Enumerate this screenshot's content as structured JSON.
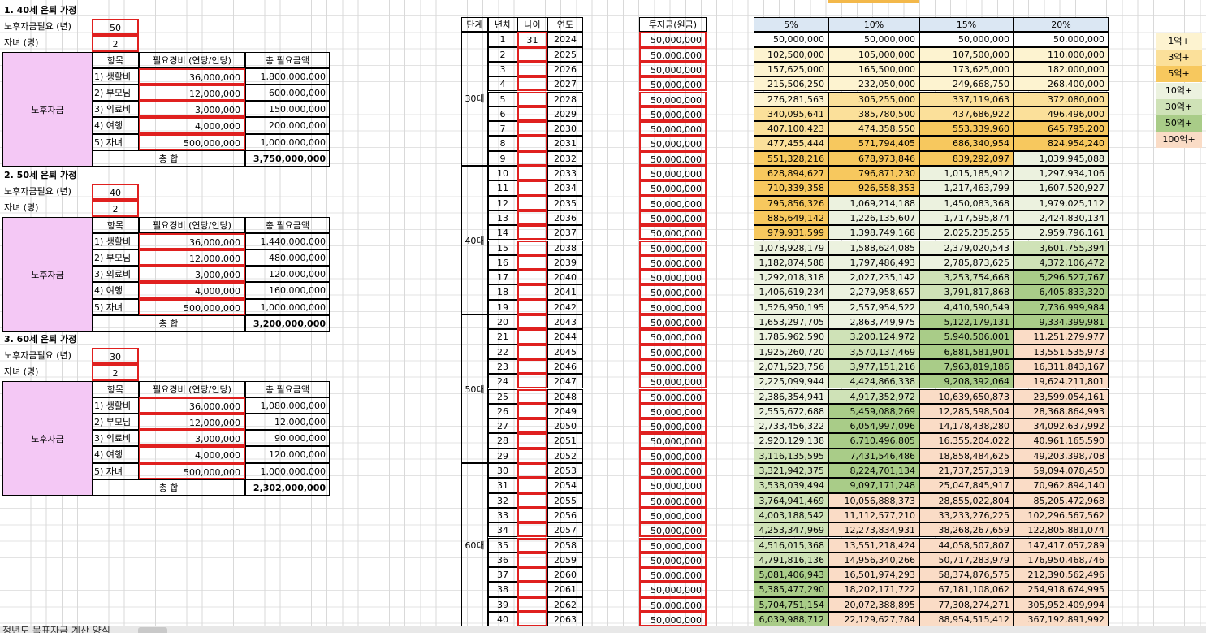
{
  "sections": [
    {
      "title": "1. 40세 은퇴 가정",
      "param1_label": "노후자금필요 (년)",
      "param1_value": "50",
      "param2_label": "자녀 (명)",
      "param2_value": "2",
      "block_label": "노후자금",
      "col_item": "항목",
      "col_expense": "필요경비 (연당/인당)",
      "col_total": "총 필요금액",
      "rows": [
        [
          "1) 생활비",
          "36,000,000",
          "1,800,000,000"
        ],
        [
          "2) 부모님",
          "12,000,000",
          "600,000,000"
        ],
        [
          "3) 의료비",
          "3,000,000",
          "150,000,000"
        ],
        [
          "4) 여행",
          "4,000,000",
          "200,000,000"
        ],
        [
          "5) 자녀",
          "500,000,000",
          "1,000,000,000"
        ]
      ],
      "sum_label": "총 합",
      "sum_value": "3,750,000,000"
    },
    {
      "title": "2. 50세 은퇴 가정",
      "param1_label": "노후자금필요 (년)",
      "param1_value": "40",
      "param2_label": "자녀 (명)",
      "param2_value": "2",
      "block_label": "노후자금",
      "col_item": "항목",
      "col_expense": "필요경비 (연당/인당)",
      "col_total": "총 필요금액",
      "rows": [
        [
          "1) 생활비",
          "36,000,000",
          "1,440,000,000"
        ],
        [
          "2) 부모님",
          "12,000,000",
          "480,000,000"
        ],
        [
          "3) 의료비",
          "3,000,000",
          "120,000,000"
        ],
        [
          "4) 여행",
          "4,000,000",
          "160,000,000"
        ],
        [
          "5) 자녀",
          "500,000,000",
          "1,000,000,000"
        ]
      ],
      "sum_label": "총 합",
      "sum_value": "3,200,000,000"
    },
    {
      "title": "3. 60세 은퇴 가정",
      "param1_label": "노후자금필요 (년)",
      "param1_value": "30",
      "param2_label": "자녀 (명)",
      "param2_value": "2",
      "block_label": "노후자금",
      "col_item": "항목",
      "col_expense": "필요경비 (연당/인당)",
      "col_total": "총 필요금액",
      "rows": [
        [
          "1) 생활비",
          "36,000,000",
          "1,080,000,000"
        ],
        [
          "2) 부모님",
          "12,000,000",
          "12,000,000"
        ],
        [
          "3) 의료비",
          "3,000,000",
          "90,000,000"
        ],
        [
          "4) 여행",
          "4,000,000",
          "120,000,000"
        ],
        [
          "5) 자녀",
          "500,000,000",
          "1,000,000,000"
        ]
      ],
      "sum_label": "총 합",
      "sum_value": "2,302,000,000"
    }
  ],
  "main": {
    "headers": {
      "stage": "단계",
      "year_no": "년차",
      "age": "나이",
      "year": "연도",
      "invest": "투자금(원금)",
      "r5": "5%",
      "r10": "10%",
      "r15": "15%",
      "r20": "20%"
    },
    "stages": [
      {
        "label": "30대",
        "start": 1,
        "end": 9
      },
      {
        "label": "40대",
        "start": 10,
        "end": 19
      },
      {
        "label": "50대",
        "start": 20,
        "end": 29
      },
      {
        "label": "60대",
        "start": 30,
        "end": 40
      }
    ],
    "first_age": "31",
    "invest_value": "50,000,000",
    "rows": [
      [
        "1",
        "2024",
        "50,000,000",
        "50,000,000",
        "50,000,000",
        "50,000,000"
      ],
      [
        "2",
        "2025",
        "102,500,000",
        "105,000,000",
        "107,500,000",
        "110,000,000"
      ],
      [
        "3",
        "2026",
        "157,625,000",
        "165,500,000",
        "173,625,000",
        "182,000,000"
      ],
      [
        "4",
        "2027",
        "215,506,250",
        "232,050,000",
        "249,668,750",
        "268,400,000"
      ],
      [
        "5",
        "2028",
        "276,281,563",
        "305,255,000",
        "337,119,063",
        "372,080,000"
      ],
      [
        "6",
        "2029",
        "340,095,641",
        "385,780,500",
        "437,686,922",
        "496,496,000"
      ],
      [
        "7",
        "2030",
        "407,100,423",
        "474,358,550",
        "553,339,960",
        "645,795,200"
      ],
      [
        "8",
        "2031",
        "477,455,444",
        "571,794,405",
        "686,340,954",
        "824,954,240"
      ],
      [
        "9",
        "2032",
        "551,328,216",
        "678,973,846",
        "839,292,097",
        "1,039,945,088"
      ],
      [
        "10",
        "2033",
        "628,894,627",
        "796,871,230",
        "1,015,185,912",
        "1,297,934,106"
      ],
      [
        "11",
        "2034",
        "710,339,358",
        "926,558,353",
        "1,217,463,799",
        "1,607,520,927"
      ],
      [
        "12",
        "2035",
        "795,856,326",
        "1,069,214,188",
        "1,450,083,368",
        "1,979,025,112"
      ],
      [
        "13",
        "2036",
        "885,649,142",
        "1,226,135,607",
        "1,717,595,874",
        "2,424,830,134"
      ],
      [
        "14",
        "2037",
        "979,931,599",
        "1,398,749,168",
        "2,025,235,255",
        "2,959,796,161"
      ],
      [
        "15",
        "2038",
        "1,078,928,179",
        "1,588,624,085",
        "2,379,020,543",
        "3,601,755,394"
      ],
      [
        "16",
        "2039",
        "1,182,874,588",
        "1,797,486,493",
        "2,785,873,625",
        "4,372,106,472"
      ],
      [
        "17",
        "2040",
        "1,292,018,318",
        "2,027,235,142",
        "3,253,754,668",
        "5,296,527,767"
      ],
      [
        "18",
        "2041",
        "1,406,619,234",
        "2,279,958,657",
        "3,791,817,868",
        "6,405,833,320"
      ],
      [
        "19",
        "2042",
        "1,526,950,195",
        "2,557,954,522",
        "4,410,590,549",
        "7,736,999,984"
      ],
      [
        "20",
        "2043",
        "1,653,297,705",
        "2,863,749,975",
        "5,122,179,131",
        "9,334,399,981"
      ],
      [
        "21",
        "2044",
        "1,785,962,590",
        "3,200,124,972",
        "5,940,506,001",
        "11,251,279,977"
      ],
      [
        "22",
        "2045",
        "1,925,260,720",
        "3,570,137,469",
        "6,881,581,901",
        "13,551,535,973"
      ],
      [
        "23",
        "2046",
        "2,071,523,756",
        "3,977,151,216",
        "7,963,819,186",
        "16,311,843,167"
      ],
      [
        "24",
        "2047",
        "2,225,099,944",
        "4,424,866,338",
        "9,208,392,064",
        "19,624,211,801"
      ],
      [
        "25",
        "2048",
        "2,386,354,941",
        "4,917,352,972",
        "10,639,650,873",
        "23,599,054,161"
      ],
      [
        "26",
        "2049",
        "2,555,672,688",
        "5,459,088,269",
        "12,285,598,504",
        "28,368,864,993"
      ],
      [
        "27",
        "2050",
        "2,733,456,322",
        "6,054,997,096",
        "14,178,438,280",
        "34,092,637,992"
      ],
      [
        "28",
        "2051",
        "2,920,129,138",
        "6,710,496,805",
        "16,355,204,022",
        "40,961,165,590"
      ],
      [
        "29",
        "2052",
        "3,116,135,595",
        "7,431,546,486",
        "18,858,484,625",
        "49,203,398,708"
      ],
      [
        "30",
        "2053",
        "3,321,942,375",
        "8,224,701,134",
        "21,737,257,319",
        "59,094,078,450"
      ],
      [
        "31",
        "2054",
        "3,538,039,494",
        "9,097,171,248",
        "25,047,845,917",
        "70,962,894,140"
      ],
      [
        "32",
        "2055",
        "3,764,941,469",
        "10,056,888,373",
        "28,855,022,804",
        "85,205,472,968"
      ],
      [
        "33",
        "2056",
        "4,003,188,542",
        "11,112,577,210",
        "33,233,276,225",
        "102,296,567,562"
      ],
      [
        "34",
        "2057",
        "4,253,347,969",
        "12,273,834,931",
        "38,268,267,659",
        "122,805,881,074"
      ],
      [
        "35",
        "2058",
        "4,516,015,368",
        "13,551,218,424",
        "44,058,507,807",
        "147,417,057,289"
      ],
      [
        "36",
        "2059",
        "4,791,816,136",
        "14,956,340,266",
        "50,717,283,979",
        "176,950,468,746"
      ],
      [
        "37",
        "2060",
        "5,081,406,943",
        "16,501,974,293",
        "58,374,876,575",
        "212,390,562,496"
      ],
      [
        "38",
        "2061",
        "5,385,477,290",
        "18,202,171,722",
        "67,181,108,062",
        "254,918,674,995"
      ],
      [
        "39",
        "2062",
        "5,704,751,154",
        "20,072,388,895",
        "77,308,274,271",
        "305,952,409,994"
      ],
      [
        "40",
        "2063",
        "6,039,988,712",
        "22,129,627,784",
        "88,954,515,412",
        "367,192,891,992"
      ]
    ]
  },
  "legend": [
    {
      "label": "1억+",
      "color": "#fdf3d0"
    },
    {
      "label": "3억+",
      "color": "#fbe09a"
    },
    {
      "label": "5억+",
      "color": "#f7c85e"
    },
    {
      "label": "10억+",
      "color": "#ecf2df"
    },
    {
      "label": "30억+",
      "color": "#cfe2b7"
    },
    {
      "label": "50억+",
      "color": "#a9cc88"
    },
    {
      "label": "100억+",
      "color": "#fadcc6"
    }
  ],
  "sheet_tab": "청년도 목표자금 계산 양식"
}
